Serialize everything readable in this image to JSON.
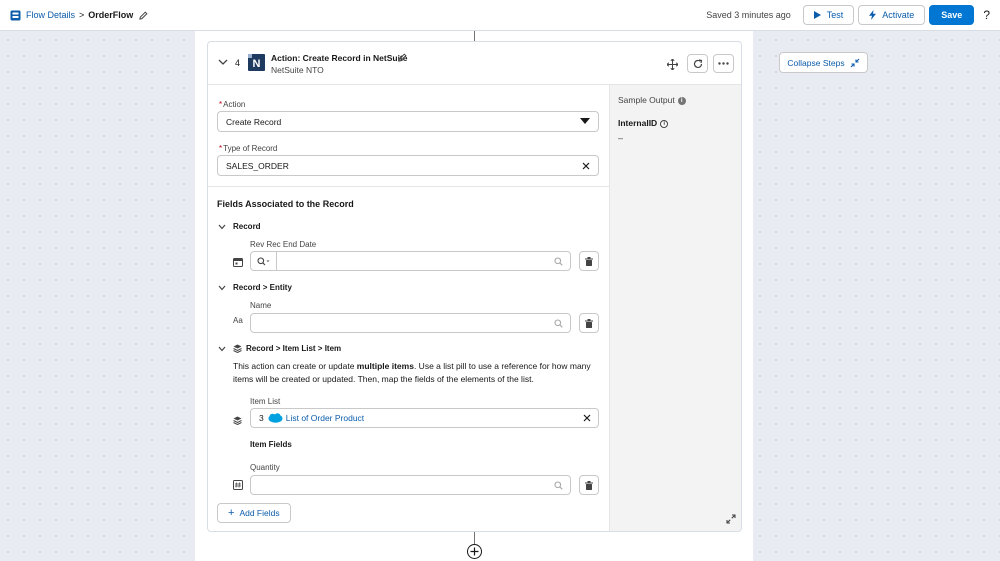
{
  "topbar": {
    "breadcrumb_root": "Flow Details",
    "breadcrumb_sep": ">",
    "flow_name": "OrderFlow",
    "saved_status": "Saved 3 minutes ago",
    "test_label": "Test",
    "activate_label": "Activate",
    "save_label": "Save",
    "help_label": "?"
  },
  "step": {
    "number": "4",
    "title": "Action: Create Record in NetSuite",
    "subtitle": "NetSuite NTO",
    "logo_letter": "N"
  },
  "form": {
    "action_label": "Action",
    "action_value": "Create Record",
    "type_label": "Type of Record",
    "type_value": "SALES_ORDER",
    "required_mark": "*"
  },
  "fields_section": {
    "title": "Fields Associated to the Record",
    "groups": [
      {
        "title": "Record",
        "field_label": "Rev Rec End Date"
      },
      {
        "title": "Record > Entity",
        "field_label": "Name"
      },
      {
        "title": "Record > Item List > Item"
      }
    ],
    "info_pre": "This action can create or update ",
    "info_bold": "multiple items",
    "info_post": ". Use a list pill to use a reference for how many items will be created or updated. Then, map the fields of the elements of the list.",
    "item_list_label": "Item List",
    "item_list_step": "3",
    "item_list_value": "List of Order Product",
    "item_fields_label": "Item Fields",
    "quantity_label": "Quantity",
    "text_type_glyph": "Aa",
    "add_fields_label": "Add Fields"
  },
  "sample_output": {
    "title": "Sample Output",
    "field": "InternalID",
    "value": "–"
  },
  "collapse_label": "Collapse Steps",
  "colors": {
    "brand": "#0176d3",
    "link": "#0b5cab",
    "required": "#ba0517"
  }
}
